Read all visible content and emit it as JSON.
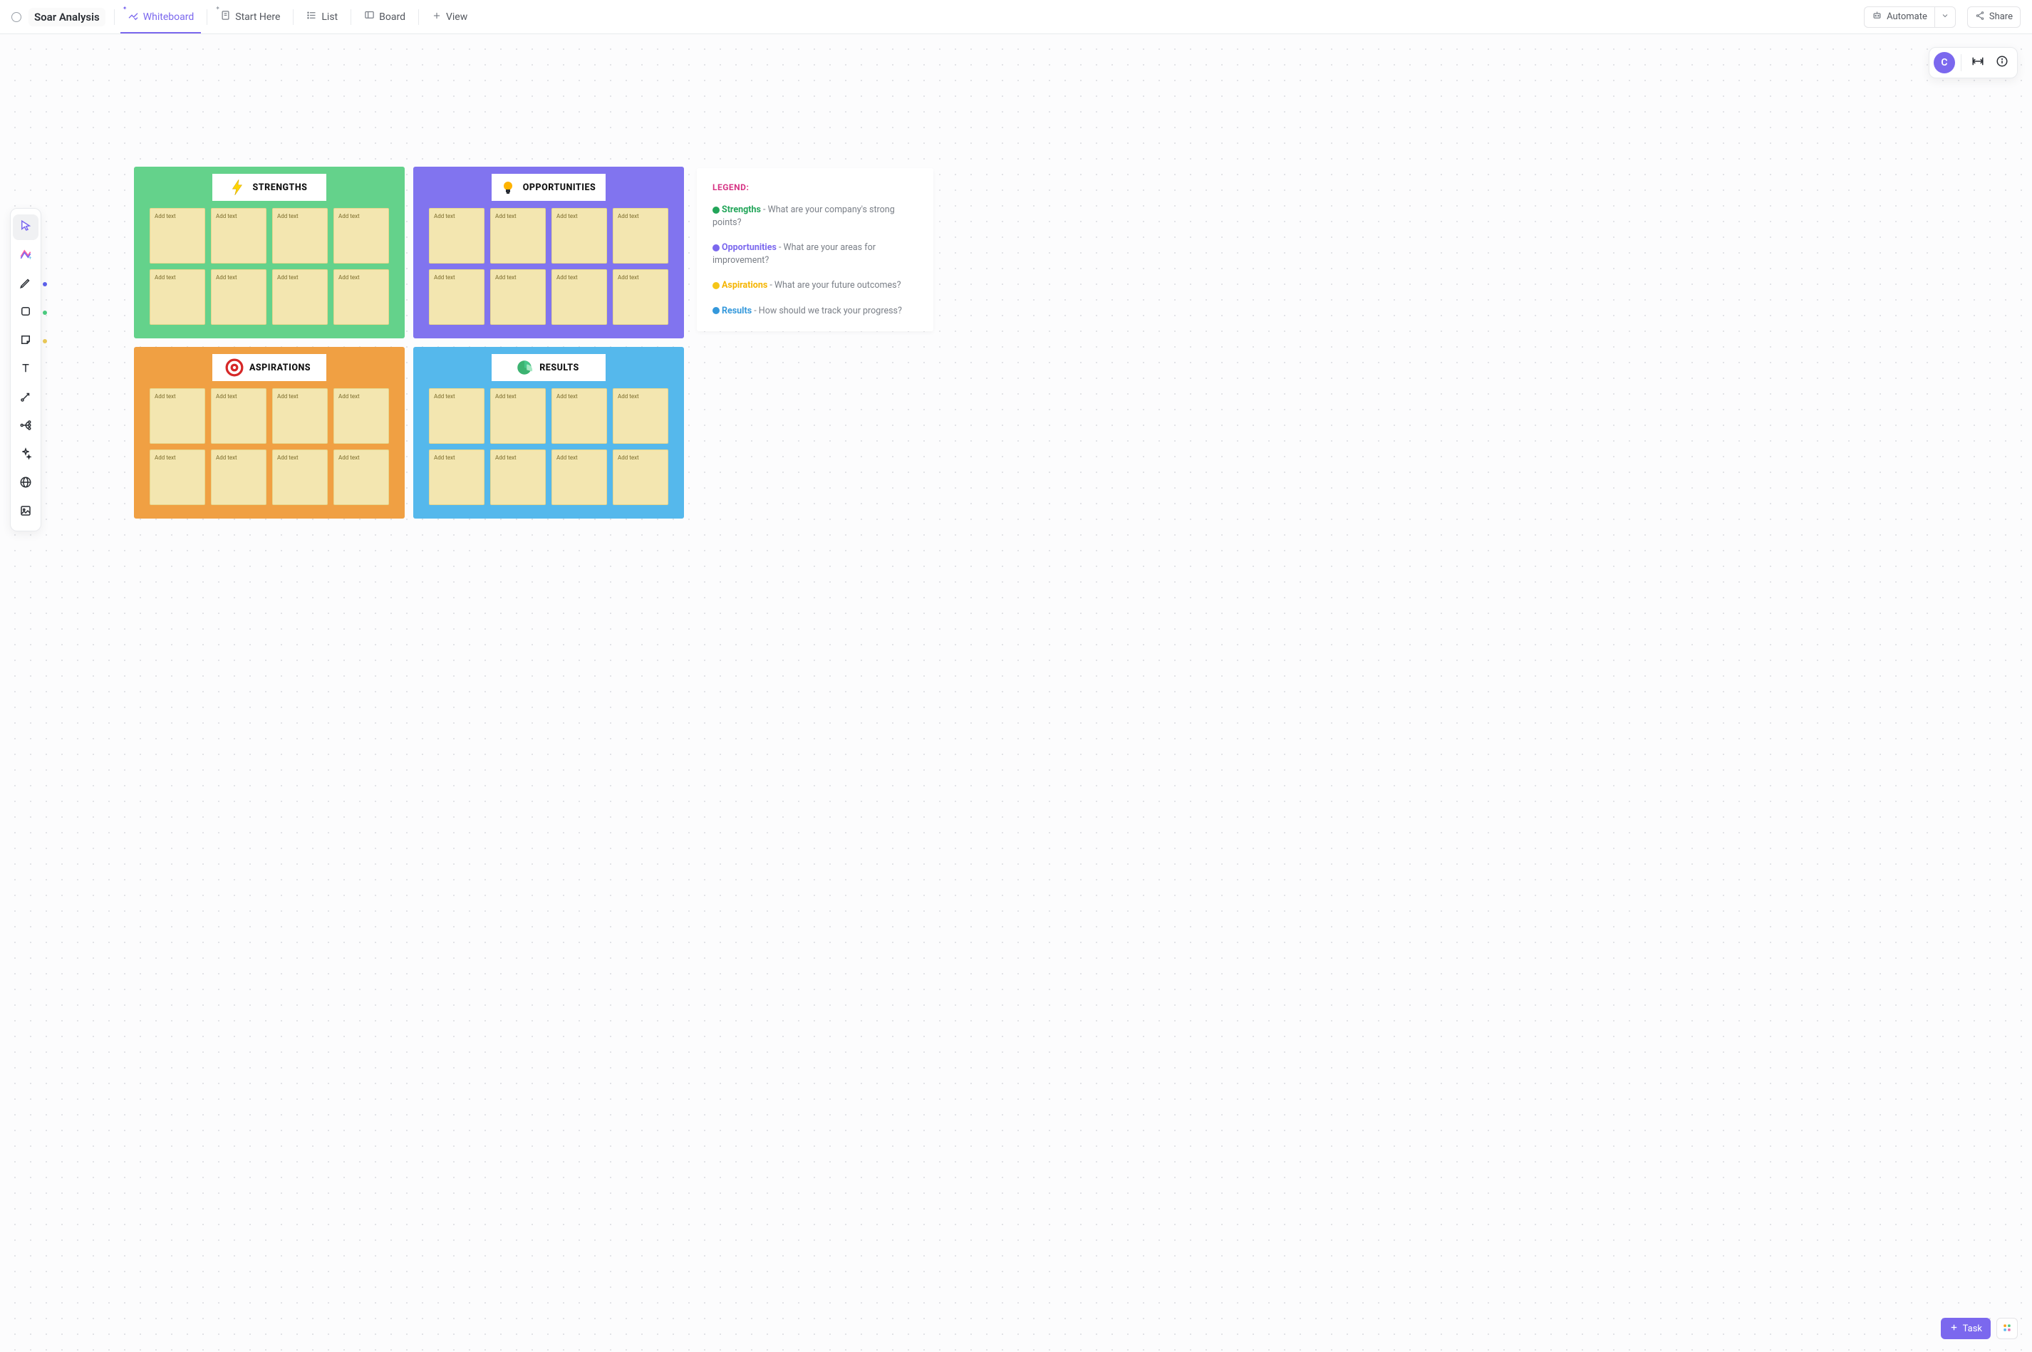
{
  "header": {
    "title": "Soar Analysis",
    "tabs": [
      {
        "id": "whiteboard",
        "label": "Whiteboard",
        "active": true
      },
      {
        "id": "start",
        "label": "Start Here",
        "active": false
      },
      {
        "id": "list",
        "label": "List",
        "active": false
      },
      {
        "id": "board",
        "label": "Board",
        "active": false
      }
    ],
    "add_view_label": "View",
    "automate_label": "Automate",
    "share_label": "Share"
  },
  "avatar": {
    "initial": "C"
  },
  "toolbar": {
    "items": [
      {
        "id": "cursor",
        "name": "cursor-tool",
        "active": true
      },
      {
        "id": "diagram",
        "name": "diagram-tool",
        "active": false
      },
      {
        "id": "pen",
        "name": "pen-tool",
        "active": false,
        "dot": "#5b5fe9"
      },
      {
        "id": "shape",
        "name": "shape-tool",
        "active": false,
        "dot": "#4ac97e"
      },
      {
        "id": "sticky",
        "name": "sticky-note-tool",
        "active": false,
        "dot": "#e7c656"
      },
      {
        "id": "text",
        "name": "text-tool",
        "active": false
      },
      {
        "id": "connector",
        "name": "connector-tool",
        "active": false
      },
      {
        "id": "mindmap",
        "name": "mindmap-tool",
        "active": false
      },
      {
        "id": "ai",
        "name": "ai-tool",
        "active": false
      },
      {
        "id": "web",
        "name": "web-embed-tool",
        "active": false
      },
      {
        "id": "image",
        "name": "image-tool",
        "active": false
      }
    ]
  },
  "quadrants": [
    {
      "id": "strengths",
      "label": "STRENGTHS",
      "bg": "#64d28b",
      "icon": "bolt"
    },
    {
      "id": "opportunities",
      "label": "OPPORTUNITIES",
      "bg": "#8174ef",
      "icon": "bulb"
    },
    {
      "id": "aspirations",
      "label": "ASPIRATIONS",
      "bg": "#f0a043",
      "icon": "target"
    },
    {
      "id": "results",
      "label": "RESULTS",
      "bg": "#55b8ec",
      "icon": "pie"
    }
  ],
  "note_placeholder": "Add text",
  "notes_per_quadrant": 8,
  "legend": {
    "title": "LEGEND:",
    "rows": [
      {
        "dot_class": "d-green",
        "strong_class": "l-green",
        "name": "Strengths",
        "sep": " - ",
        "desc": "What are your company's strong points?"
      },
      {
        "dot_class": "d-purple",
        "strong_class": "l-purple",
        "name": "Opportunities",
        "sep": " - ",
        "desc": "What are your areas for improvement?"
      },
      {
        "dot_class": "d-yellow",
        "strong_class": "l-yellow",
        "name": "Aspirations",
        "sep": " - ",
        "desc": "What are your future outcomes?"
      },
      {
        "dot_class": "d-blue",
        "strong_class": "l-blue",
        "name": "Results",
        "sep": " - ",
        "desc": "How should we track your progress?"
      }
    ]
  },
  "task_button_label": "Task"
}
